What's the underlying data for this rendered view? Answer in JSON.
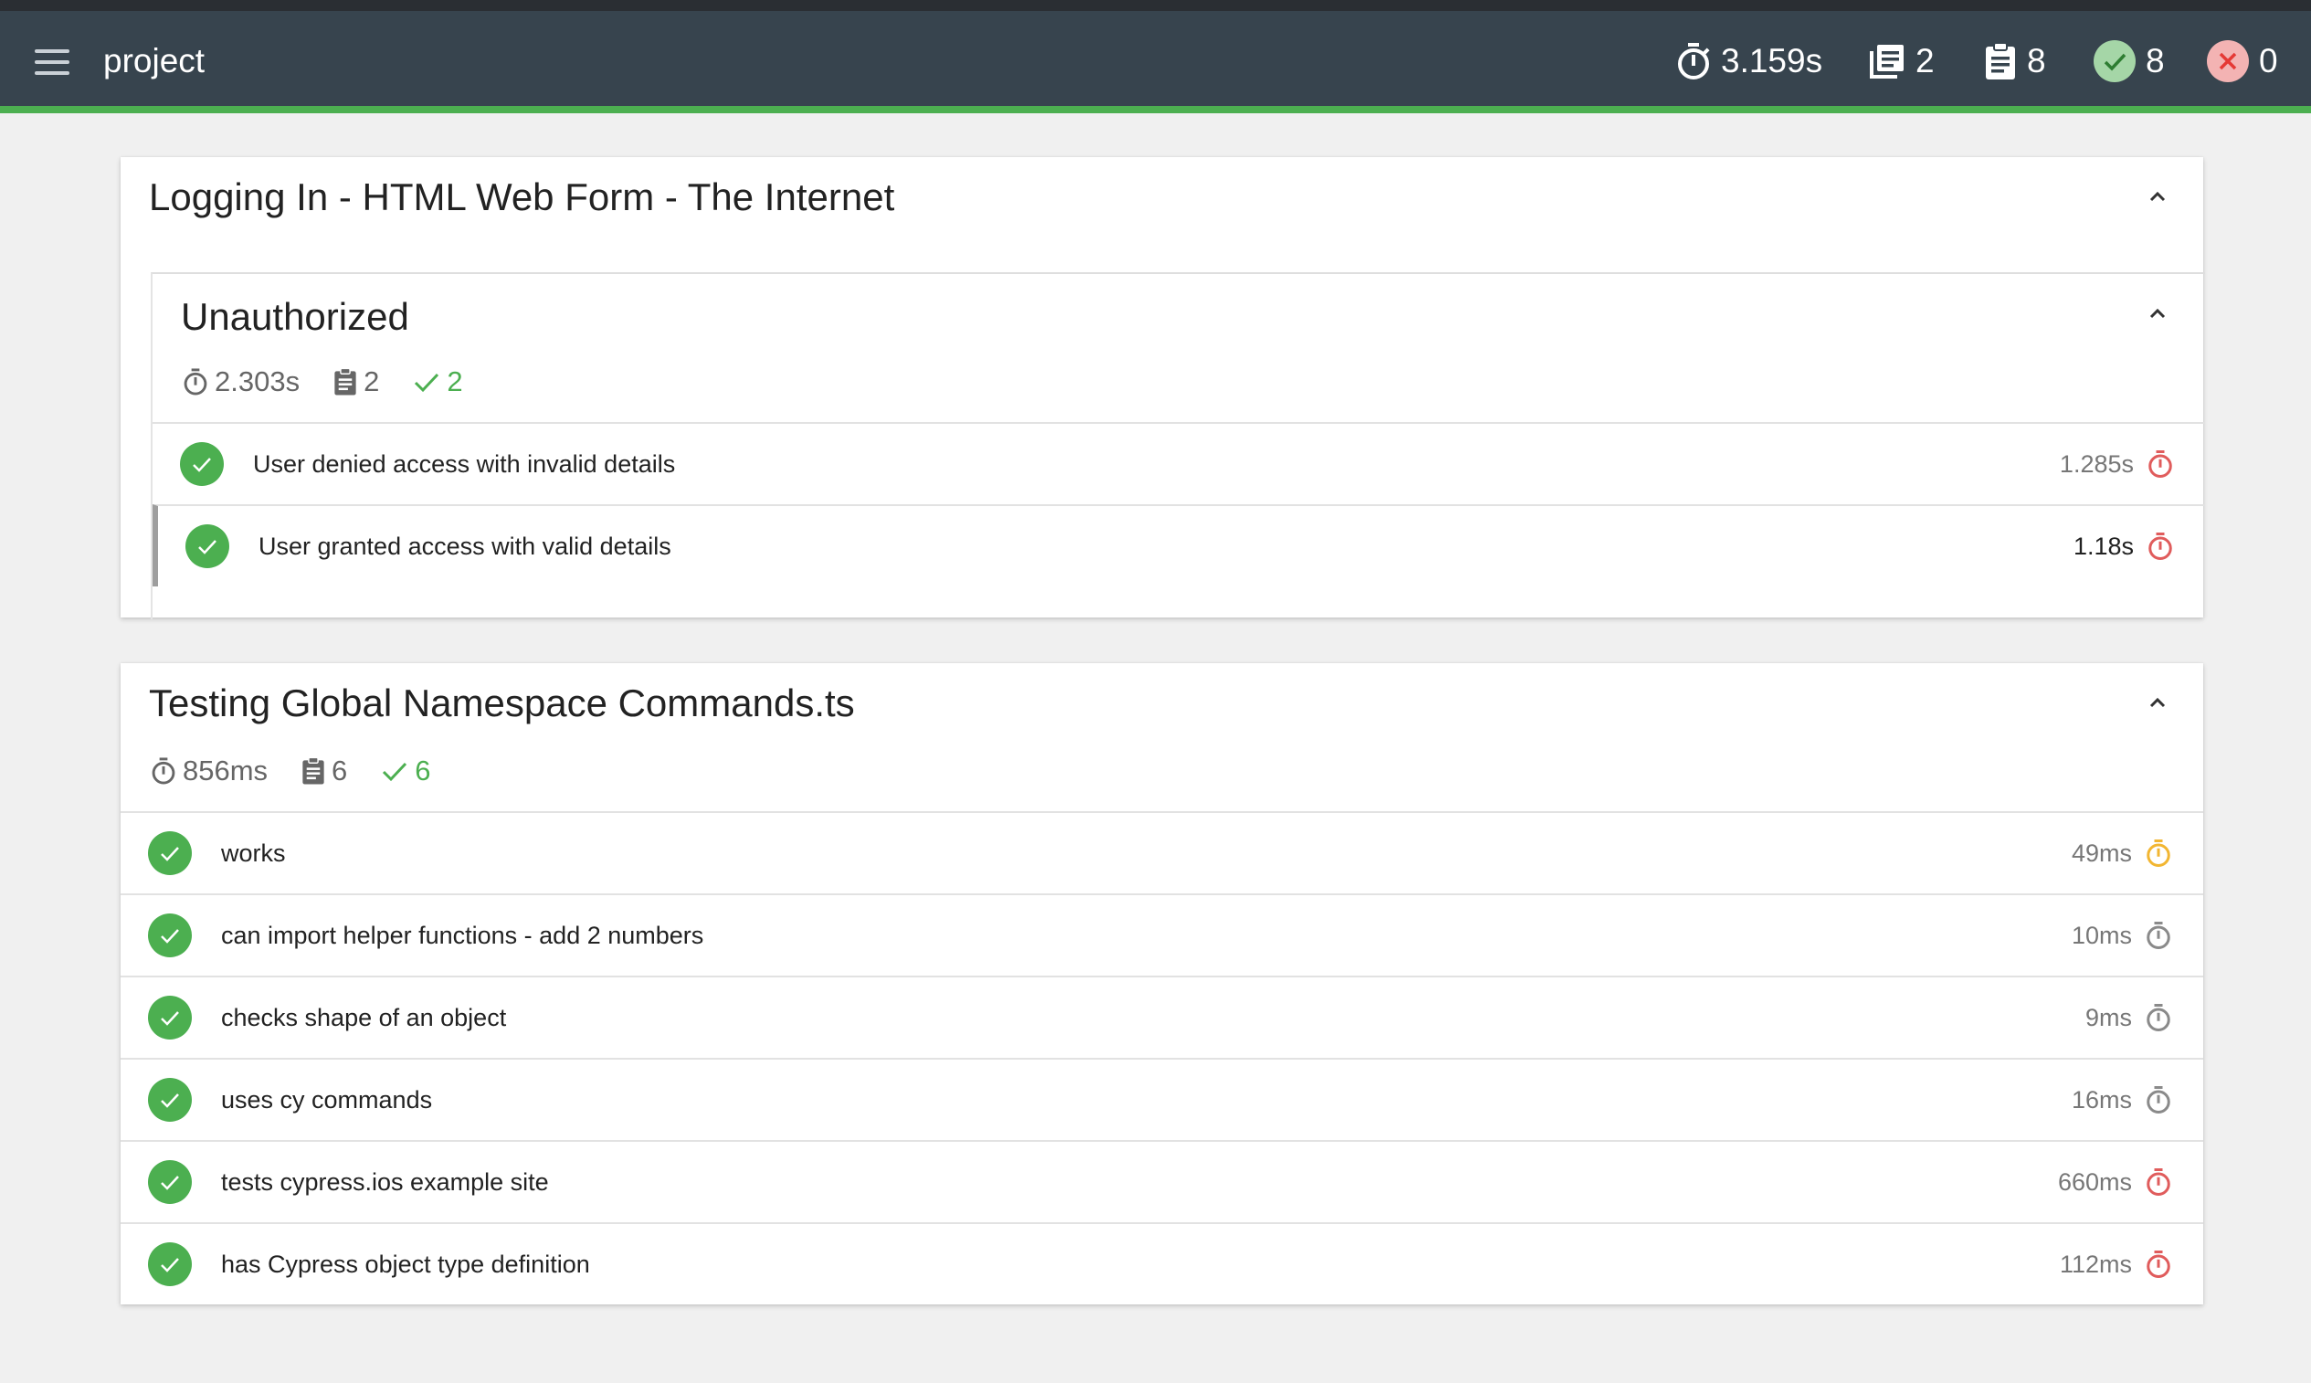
{
  "header": {
    "title": "project",
    "stats": {
      "duration": "3.159s",
      "suites": "2",
      "tests": "8",
      "passed": "8",
      "failed": "0"
    }
  },
  "suites": [
    {
      "title": "Logging In - HTML Web Form - The Internet",
      "subsuites": [
        {
          "title": "Unauthorized",
          "meta": {
            "duration": "2.303s",
            "tests": "2",
            "passed": "2"
          },
          "tests": [
            {
              "name": "User denied access with invalid details",
              "duration": "1.285s",
              "speed": "slow"
            },
            {
              "name": "User granted access with valid details",
              "duration": "1.18s",
              "speed": "slow"
            }
          ]
        }
      ]
    },
    {
      "title": "Testing Global Namespace Commands.ts",
      "meta": {
        "duration": "856ms",
        "tests": "6",
        "passed": "6"
      },
      "tests": [
        {
          "name": "works",
          "duration": "49ms",
          "speed": "medium"
        },
        {
          "name": "can import helper functions - add 2 numbers",
          "duration": "10ms",
          "speed": "fast"
        },
        {
          "name": "checks shape of an object",
          "duration": "9ms",
          "speed": "fast"
        },
        {
          "name": "uses cy commands",
          "duration": "16ms",
          "speed": "fast"
        },
        {
          "name": "tests cypress.ios example site",
          "duration": "660ms",
          "speed": "slow"
        },
        {
          "name": "has Cypress object type definition",
          "duration": "112ms",
          "speed": "slow"
        }
      ]
    }
  ],
  "colors": {
    "navbar": "#37444e",
    "accent": "#4caf50",
    "fail": "#e57373",
    "slow": "#e05c5c",
    "medium": "#f2b632",
    "fast": "#8a8a8a"
  },
  "icons": [
    "menu-icon",
    "stopwatch-icon",
    "suites-icon",
    "clipboard-icon",
    "check-circle-icon",
    "x-circle-icon",
    "chevron-up-icon",
    "check-icon"
  ]
}
